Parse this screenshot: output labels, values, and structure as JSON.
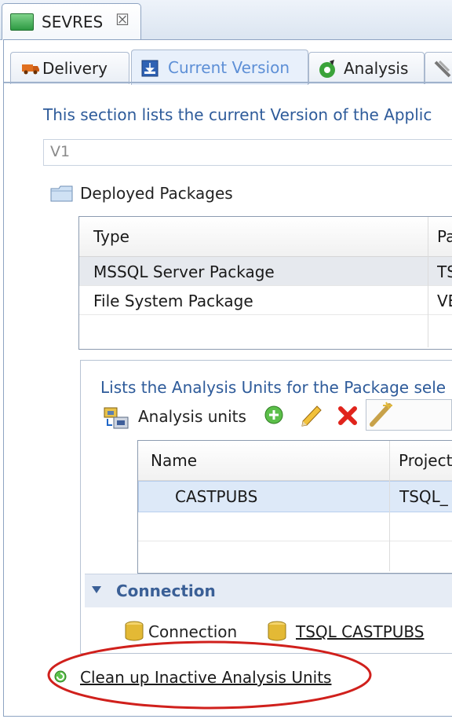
{
  "editor_tab": {
    "title": "SEVRES",
    "close_glyph": "☒"
  },
  "form_tabs": [
    {
      "label": "Delivery",
      "icon": "truck-icon",
      "active": false
    },
    {
      "label": "Current Version",
      "icon": "download-box-icon",
      "active": true
    },
    {
      "label": "Analysis",
      "icon": "gear-analysis-icon",
      "active": false
    },
    {
      "label": "",
      "icon": "tools-icon",
      "active": false
    }
  ],
  "section": {
    "description": "This section lists the current Version of the Applic",
    "version_value": "V1"
  },
  "deployed_packages": {
    "title": "Deployed Packages",
    "columns": [
      "Type",
      "Pa"
    ],
    "rows": [
      {
        "type": "MSSQL Server Package",
        "pa": "TS",
        "selected": true
      },
      {
        "type": "File System Package",
        "pa": "VE",
        "selected": false
      }
    ]
  },
  "analysis_units": {
    "description": "Lists the Analysis Units for the Package sele",
    "label": "Analysis units",
    "toolbar": {
      "add_icon": "add-icon",
      "edit_icon": "pencil-icon",
      "delete_icon": "delete-icon",
      "wizard_icon": "wand-icon"
    },
    "columns": [
      "Name",
      "Project"
    ],
    "rows": [
      {
        "name": "CASTPUBS",
        "project": "TSQL_",
        "selected": true
      }
    ]
  },
  "connection": {
    "section_title": "Connection",
    "label": "Connection",
    "link": "TSQL CASTPUBS"
  },
  "cleanup": {
    "link_text": "Clean up Inactive Analysis Units"
  },
  "colors": {
    "accent_blue": "#2e5b9a",
    "active_tab_text": "#5d8fd6",
    "selection": "#dde9f8",
    "annotation_red": "#d0201c"
  }
}
